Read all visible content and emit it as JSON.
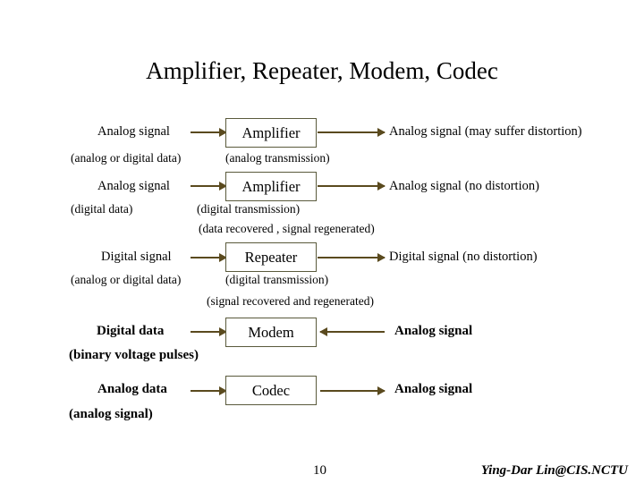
{
  "slide": {
    "title": "Amplifier, Repeater, Modem, Codec",
    "page_number": "10",
    "footer_credit": "Ying-Dar Lin@CIS.NCTU"
  },
  "rows": [
    {
      "left_label": "Analog signal",
      "left_sublabel": "(analog or digital data)",
      "box": "Amplifier",
      "box_sublabel": "(analog transmission)",
      "right_label": "Analog signal (may suffer distortion)"
    },
    {
      "left_label": "Analog signal",
      "left_sublabel": "(digital data)",
      "box": "Amplifier",
      "box_sublabel": "(digital transmission)",
      "box_note": "(data recovered , signal regenerated)",
      "right_label": "Analog signal (no distortion)"
    },
    {
      "left_label": "Digital signal",
      "left_sublabel": "(analog or digital data)",
      "box": "Repeater",
      "box_sublabel": "(digital transmission)",
      "box_note": "(signal recovered and regenerated)",
      "right_label": "Digital signal (no distortion)"
    },
    {
      "left_label": "Digital data",
      "left_sublabel": "(binary voltage pulses)",
      "box": "Modem",
      "right_label": "Analog signal"
    },
    {
      "left_label": "Analog data",
      "left_sublabel": "(analog signal)",
      "box": "Codec",
      "right_label": "Analog signal"
    }
  ],
  "colors": {
    "arrow": "#5a4a1e",
    "box_border": "#5a5a3c",
    "text": "#000000",
    "background": "#ffffff"
  }
}
